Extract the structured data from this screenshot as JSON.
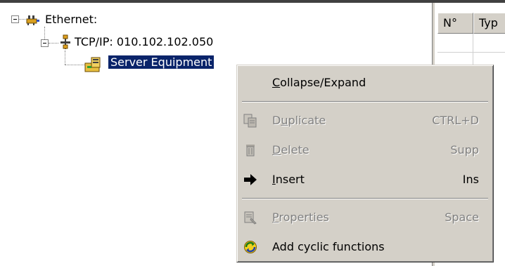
{
  "tree": {
    "nodes": [
      {
        "label": "Ethernet:",
        "icon": "network-icon"
      },
      {
        "label": "TCP/IP: 010.102.102.050",
        "icon": "tcpip-icon"
      },
      {
        "label": "Server Equipment",
        "icon": "server-equipment-icon",
        "selected": true
      }
    ]
  },
  "grid": {
    "columns": [
      "N°",
      "Typ"
    ]
  },
  "menu": {
    "items": [
      {
        "pre": "",
        "mnemonic": "C",
        "post": "ollapse/Expand",
        "shortcut": "",
        "enabled": true,
        "icon": ""
      },
      {
        "pre": "D",
        "mnemonic": "u",
        "post": "plicate",
        "shortcut": "CTRL+D",
        "enabled": false,
        "icon": "duplicate-icon"
      },
      {
        "pre": "",
        "mnemonic": "D",
        "post": "elete",
        "shortcut": "Supp",
        "enabled": false,
        "icon": "delete-icon"
      },
      {
        "pre": "",
        "mnemonic": "I",
        "post": "nsert",
        "shortcut": "Ins",
        "enabled": true,
        "icon": "arrow-right-icon"
      },
      {
        "pre": "",
        "mnemonic": "P",
        "post": "roperties",
        "shortcut": "Space",
        "enabled": false,
        "icon": "properties-icon"
      },
      {
        "pre": "Add cyclic functions",
        "mnemonic": "",
        "post": "",
        "shortcut": "",
        "enabled": true,
        "icon": "cyclic-functions-icon"
      }
    ]
  },
  "colors": {
    "selection": "#0a246a",
    "menu_bg": "#d4d0c8",
    "disabled_text": "#808080"
  }
}
